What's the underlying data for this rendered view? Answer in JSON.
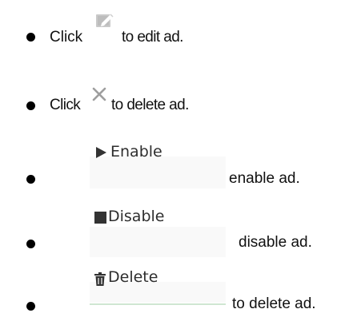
{
  "items": [
    {
      "prefix": "Click",
      "icon": "edit-icon",
      "suffix": "to edit ad."
    },
    {
      "prefix": "Click",
      "icon": "close-icon",
      "suffix": "to delete ad."
    },
    {
      "button_label": "Enable",
      "icon": "play-icon",
      "suffix": "enable ad."
    },
    {
      "button_label": "Disable",
      "icon": "stop-square-icon",
      "suffix": "disable ad."
    },
    {
      "button_label": "Delete",
      "icon": "trash-icon",
      "suffix": "to delete ad."
    }
  ]
}
